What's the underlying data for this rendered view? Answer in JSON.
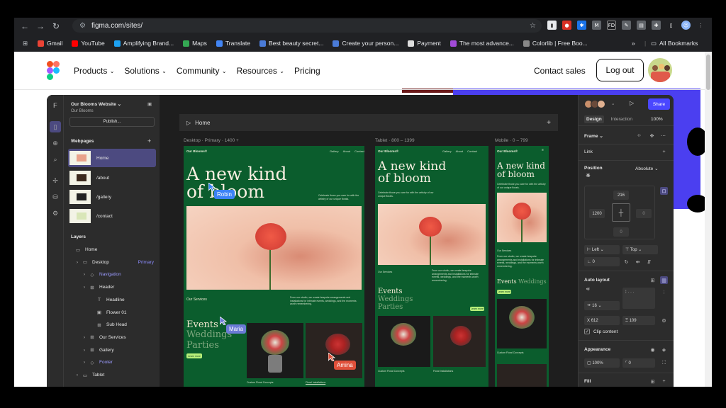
{
  "browser": {
    "url": "figma.com/sites/",
    "bookmarks": [
      {
        "label": "Gmail",
        "color": "#ea4335"
      },
      {
        "label": "YouTube",
        "color": "#ff0000"
      },
      {
        "label": "Amplifying Brand...",
        "color": "#1da1f2"
      },
      {
        "label": "Maps",
        "color": "#34a853"
      },
      {
        "label": "Translate",
        "color": "#4285f4"
      },
      {
        "label": "Best beauty secret...",
        "color": "#4a7bd8"
      },
      {
        "label": "Create your person...",
        "color": "#4a7bd8"
      },
      {
        "label": "Payment",
        "color": "#dddddd"
      },
      {
        "label": "The most advance...",
        "color": "#a24bd8"
      },
      {
        "label": "Colorlib | Free Boo...",
        "color": "#888888"
      }
    ],
    "more_label": "»",
    "all_bookmarks": "All Bookmarks"
  },
  "site": {
    "menu": [
      "Products",
      "Solutions",
      "Community",
      "Resources",
      "Pricing"
    ],
    "contact": "Contact sales",
    "logout": "Log out"
  },
  "editor": {
    "site_name": "Our Blooms Website",
    "site_sub": "Our Blooms",
    "publish": "Publish...",
    "webpages_heading": "Webpages",
    "pages": [
      "Home",
      "/about",
      "/gallery",
      "/contact"
    ],
    "layers_heading": "Layers",
    "layers": [
      {
        "label": "Home",
        "indent": 0,
        "icon": "▭"
      },
      {
        "label": "Desktop",
        "indent": 1,
        "icon": "▭",
        "tag": "Primary"
      },
      {
        "label": "Navigation",
        "indent": 2,
        "icon": "◇",
        "purple": true
      },
      {
        "label": "Header",
        "indent": 2,
        "icon": "⊞"
      },
      {
        "label": "Headline",
        "indent": 3,
        "icon": "T"
      },
      {
        "label": "Flower 01",
        "indent": 3,
        "icon": "▣"
      },
      {
        "label": "Sub Head",
        "indent": 3,
        "icon": "⊞"
      },
      {
        "label": "Our Services",
        "indent": 2,
        "icon": "⊞"
      },
      {
        "label": "Gallery",
        "indent": 2,
        "icon": "⊞"
      },
      {
        "label": "Footer",
        "indent": 2,
        "icon": "◇",
        "purple": true
      },
      {
        "label": "Tablet",
        "indent": 1,
        "icon": "▭"
      }
    ],
    "canvas": {
      "tab": "Home",
      "breakpoints": [
        "Desktop · Primary · 1400 +",
        "Tablet · 800 – 1399",
        "Mobile · 0 – 799"
      ],
      "brand": "Our Blooms®",
      "links": [
        "Gallery",
        "About",
        "Contact"
      ],
      "hero_line1": "A new kind",
      "hero_line2": "of bloom",
      "hero_body": "Celebrate those you care for with the artistry of our unique florals.",
      "services": "Our Services",
      "services_body": "From our studio, we create bespoke arrangements and installations for intimate events, weddings, and the moments worth remembering.",
      "events": "Events",
      "weddings": "Weddings",
      "parties": "Parties",
      "cta": "Learn more",
      "caption1": "Custom Floral Concepts",
      "caption2": "Floral Installations",
      "cursors": [
        {
          "name": "Robin",
          "color": "#3b82f6"
        },
        {
          "name": "Maria",
          "color": "#6b7bd6"
        },
        {
          "name": "Amina",
          "color": "#e0503a"
        }
      ]
    },
    "right": {
      "tabs": [
        "Design",
        "Interaction"
      ],
      "zoom": "100%",
      "share": "Share",
      "frame": "Frame",
      "link": "Link",
      "position": "Position",
      "position_mode": "Absolute",
      "top": "216",
      "left": "1200",
      "right": "0",
      "bottom": "0",
      "h_constraint": "Left",
      "v_constraint": "Top",
      "rotation": "0",
      "auto_layout": "Auto layout",
      "gap": "16",
      "width": "612",
      "height": "109",
      "clip": "Clip content",
      "appearance": "Appearance",
      "opacity": "100%",
      "radius": "0",
      "fill": "Fill"
    }
  }
}
